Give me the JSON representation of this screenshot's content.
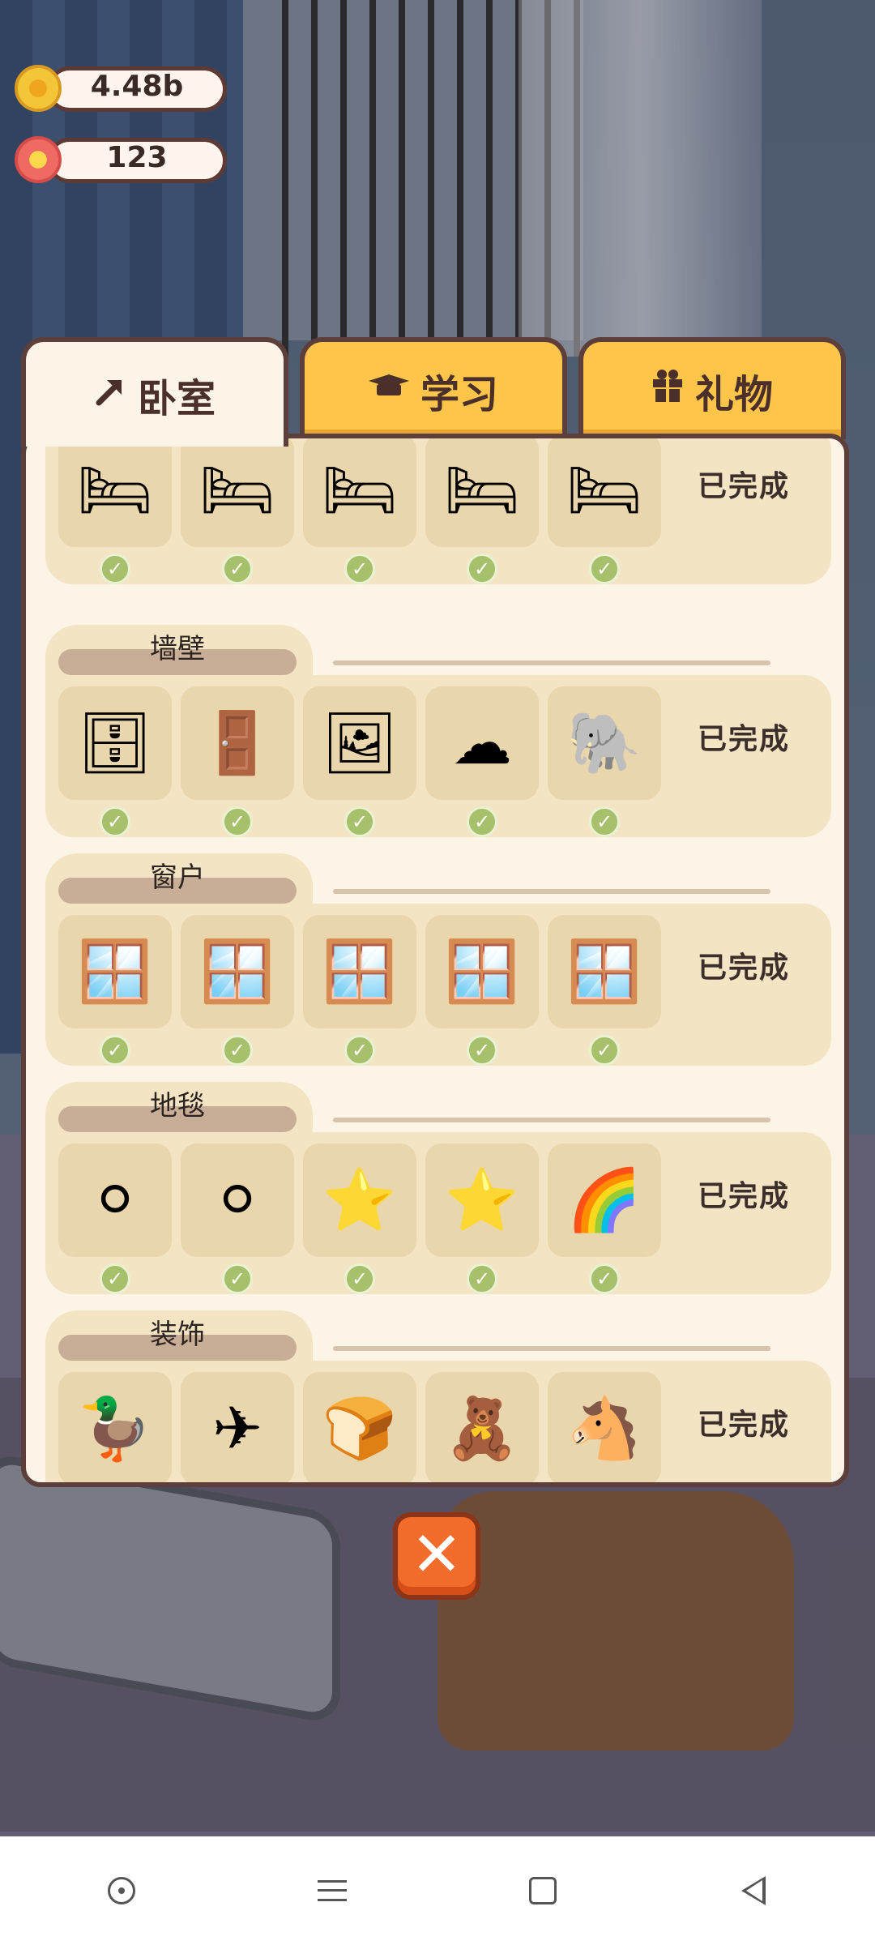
{
  "currency": [
    {
      "name": "coin",
      "value": "4.48b"
    },
    {
      "name": "flower",
      "value": "123"
    }
  ],
  "tabs": [
    {
      "label": "卧室",
      "icon": "hammer-icon",
      "active": true
    },
    {
      "label": "学习",
      "icon": "graduation-cap-icon",
      "active": false
    },
    {
      "label": "礼物",
      "icon": "gift-icon",
      "active": false
    }
  ],
  "categories": [
    {
      "title": "",
      "status": "已完成",
      "items": [
        "wooden-bed",
        "blue-bed",
        "white-bed",
        "pink-crib",
        "mobile-crib"
      ],
      "icons": [
        "🛏",
        "🛏",
        "🛏",
        "🛏",
        "🛏"
      ],
      "completed": [
        true,
        true,
        true,
        true,
        true
      ]
    },
    {
      "title": "墙壁",
      "status": "已完成",
      "items": [
        "shelf",
        "pink-door",
        "photo-frames",
        "clouds",
        "animal-decals"
      ],
      "icons": [
        "🗄",
        "🚪",
        "🖼",
        "☁",
        "🐘"
      ],
      "completed": [
        true,
        true,
        true,
        true,
        true
      ]
    },
    {
      "title": "窗户",
      "status": "已完成",
      "items": [
        "small-window",
        "double-window",
        "tall-window",
        "curtain-window",
        "blue-curtain-window"
      ],
      "icons": [
        "🪟",
        "🪟",
        "🪟",
        "🪟",
        "🪟"
      ],
      "completed": [
        true,
        true,
        true,
        true,
        true
      ]
    },
    {
      "title": "地毯",
      "status": "已完成",
      "items": [
        "small-rug",
        "oval-rug",
        "star-rug",
        "star-rug-grey",
        "rainbow-star-rug"
      ],
      "icons": [
        "⚪",
        "⚪",
        "⭐",
        "⭐",
        "🌈"
      ],
      "completed": [
        true,
        true,
        true,
        true,
        true
      ]
    },
    {
      "title": "装饰",
      "status": "已完成",
      "items": [
        "duck",
        "airplane",
        "cat-bread",
        "teddy-bear",
        "rocking-horse"
      ],
      "icons": [
        "🦆",
        "✈",
        "🍞",
        "🧸",
        "🐴"
      ],
      "completed": [
        true,
        true,
        true,
        true,
        true
      ]
    }
  ],
  "close_icon": "close-icon",
  "navbar": [
    "circle-icon",
    "menu-icon",
    "home-icon",
    "back-icon"
  ],
  "colors": {
    "tab_active": "#fcf4e6",
    "tab_inactive": "#fdc64a",
    "check": "#a7c06b",
    "close": "#f26d2c"
  }
}
